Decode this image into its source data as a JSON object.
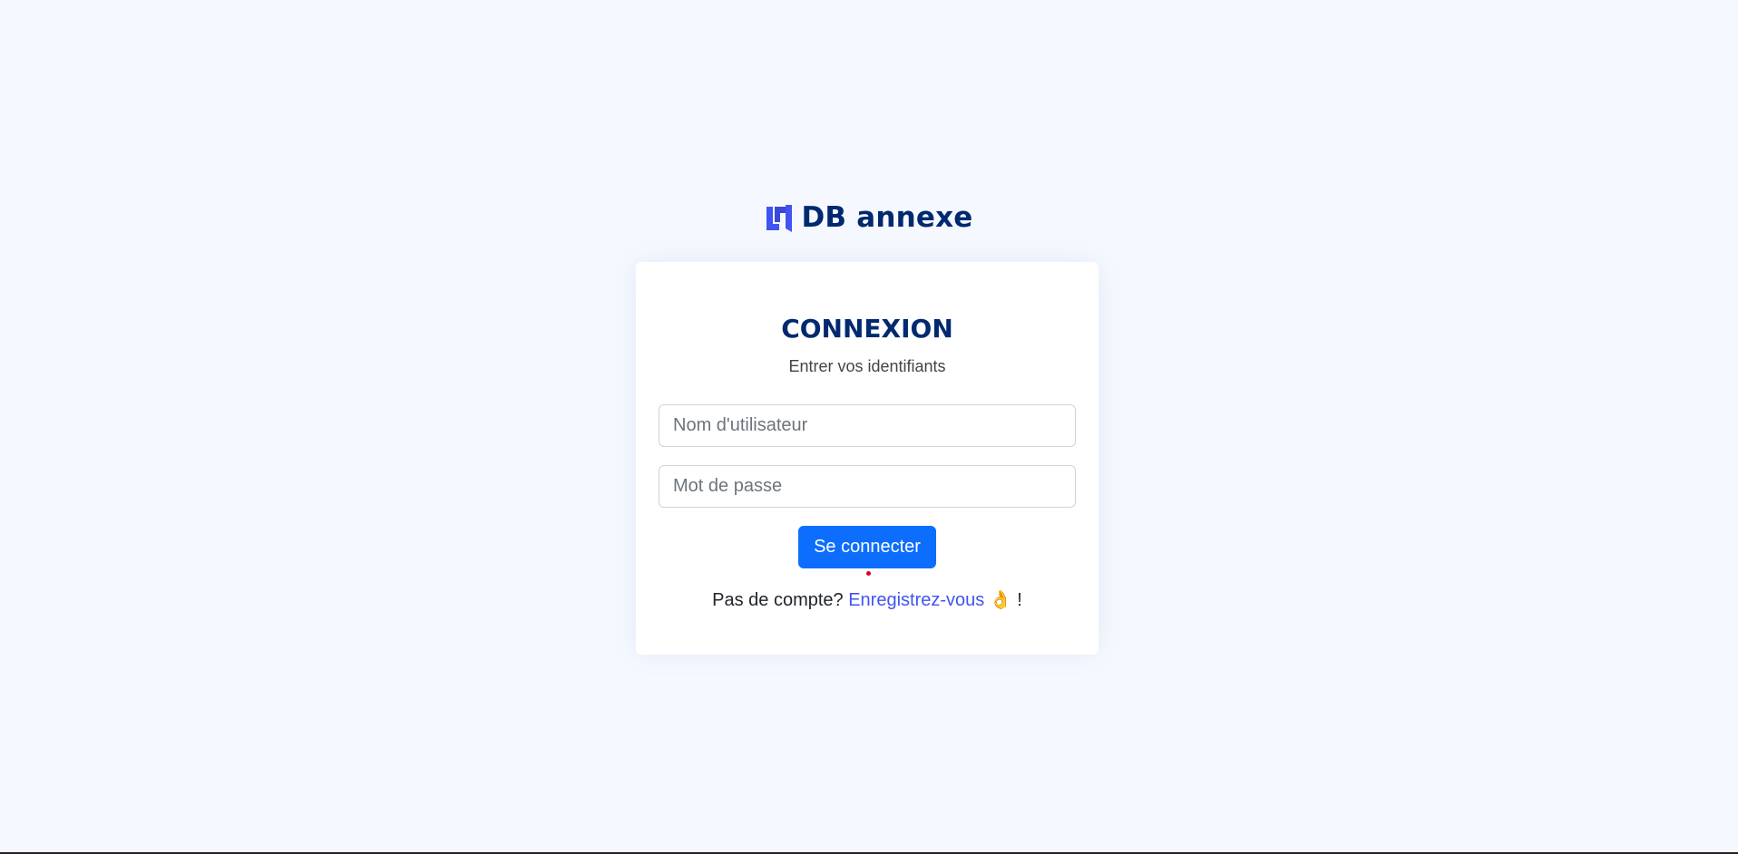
{
  "brand": {
    "name": "DB annexe",
    "icon": "db-annexe-logo-icon",
    "color": "#012970",
    "accent": "#4154f1"
  },
  "login": {
    "title": "CONNEXION",
    "subtitle": "Entrer vos identifiants",
    "username_placeholder": "Nom d'utilisateur",
    "username_value": "",
    "password_placeholder": "Mot de passe",
    "password_value": "",
    "submit_label": "Se connecter",
    "submit_color": "#0d6efd"
  },
  "register": {
    "prompt": "Pas de compte? ",
    "link_label": "Enregistrez-vous",
    "emoji": "👌",
    "suffix": " !"
  }
}
